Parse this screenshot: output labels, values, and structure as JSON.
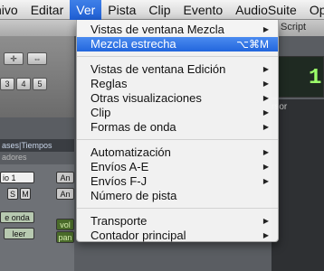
{
  "menubar": {
    "items": [
      {
        "label": "hivo"
      },
      {
        "label": "Editar"
      },
      {
        "label": "Ver"
      },
      {
        "label": "Pista"
      },
      {
        "label": "Clip"
      },
      {
        "label": "Evento"
      },
      {
        "label": "AudioSuite"
      },
      {
        "label": "Opc"
      }
    ],
    "active_index": 2
  },
  "background": {
    "script_label": "Script",
    "counter_digit": "1",
    "cursor_label": "rsor",
    "mix_header": "ases|Tiempos",
    "mix_sub": "adores",
    "track_name": "io 1",
    "tool_buttons": [
      "3",
      "4",
      "5"
    ],
    "chips": [
      "S",
      "M",
      "An",
      "An",
      "e onda",
      "leer",
      "vol",
      "pan"
    ]
  },
  "ver_menu": {
    "groups": [
      [
        {
          "label": "Vistas de ventana Mezcla",
          "submenu": true
        },
        {
          "label": "Mezcla estrecha",
          "shortcut": "⌥⌘M",
          "highlighted": true
        }
      ],
      [
        {
          "label": "Vistas de ventana Edición",
          "submenu": true
        },
        {
          "label": "Reglas",
          "submenu": true
        },
        {
          "label": "Otras visualizaciones",
          "submenu": true
        },
        {
          "label": "Clip",
          "submenu": true
        },
        {
          "label": "Formas de onda",
          "submenu": true
        }
      ],
      [
        {
          "label": "Automatización",
          "submenu": true
        },
        {
          "label": "Envíos A-E",
          "submenu": true
        },
        {
          "label": "Envíos F-J",
          "submenu": true
        },
        {
          "label": "Número de pista"
        }
      ],
      [
        {
          "label": "Transporte",
          "submenu": true
        },
        {
          "label": "Contador principal",
          "submenu": true
        }
      ]
    ]
  }
}
